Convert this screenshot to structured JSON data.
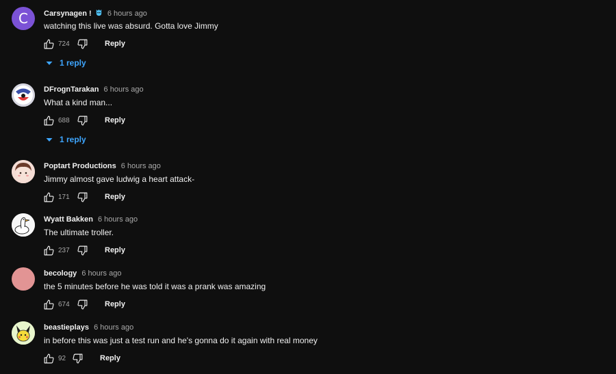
{
  "comments": [
    {
      "author": "Carsynagen !",
      "time": "6 hours ago",
      "text": "watching this live was absurd. Gotta love Jimmy",
      "likes": "724",
      "reply_label": "Reply",
      "replies_label": "1 reply",
      "avatar_letter": "C",
      "avatar_color": "#7b52d6",
      "has_badge": true
    },
    {
      "author": "DFrognTarakan",
      "time": "6 hours ago",
      "text": "What a kind man...",
      "likes": "688",
      "reply_label": "Reply",
      "replies_label": "1 reply",
      "avatar_color": "#c9c9d6"
    },
    {
      "author": "Poptart Productions",
      "time": "6 hours ago",
      "text": "Jimmy almost gave ludwig a heart attack-",
      "likes": "171",
      "reply_label": "Reply",
      "avatar_color": "#f2d4cc"
    },
    {
      "author": "Wyatt Bakken",
      "time": "6 hours ago",
      "text": "The ultimate troller.",
      "likes": "237",
      "reply_label": "Reply",
      "avatar_color": "#f4f4f4"
    },
    {
      "author": "becology",
      "time": "6 hours ago",
      "text": "the 5 minutes before he was told it was a prank was amazing",
      "likes": "674",
      "reply_label": "Reply",
      "avatar_color": "#e29494"
    },
    {
      "author": "beastieplays",
      "time": "6 hours ago",
      "text": "in before this was just a test run and he's gonna do it again with real money",
      "likes": "92",
      "reply_label": "Reply",
      "avatar_color": "#e6f5c9"
    }
  ],
  "colors": {
    "background": "#0f0f0f",
    "text": "#f1f1f1",
    "muted": "#aaaaaa",
    "link": "#3ea6ff"
  }
}
